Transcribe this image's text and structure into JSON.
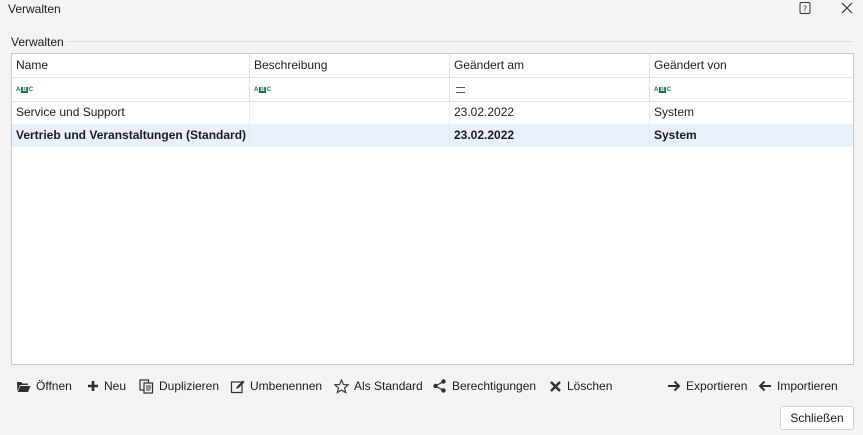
{
  "window": {
    "title": "Verwalten"
  },
  "group": {
    "label": "Verwalten"
  },
  "table": {
    "columns": [
      "Name",
      "Beschreibung",
      "Geändert am",
      "Geändert von"
    ],
    "filter_icons": [
      "abc-text-filter-icon",
      "abc-text-filter-icon",
      "equals-filter-icon",
      "abc-text-filter-icon"
    ],
    "rows": [
      {
        "name": "Service und Support",
        "beschreibung": "",
        "geaendert_am": "23.02.2022",
        "geaendert_von": "System",
        "selected": false
      },
      {
        "name": "Vertrieb und Veranstaltungen (Standard)",
        "beschreibung": "",
        "geaendert_am": "23.02.2022",
        "geaendert_von": "System",
        "selected": true
      }
    ]
  },
  "toolbar": {
    "open": "Öffnen",
    "new": "Neu",
    "duplicate": "Duplizieren",
    "rename": "Umbenennen",
    "set_default": "Als Standard",
    "permissions": "Berechtigungen",
    "delete": "Löschen",
    "export": "Exportieren",
    "import": "Importieren"
  },
  "buttons": {
    "close": "Schließen"
  }
}
